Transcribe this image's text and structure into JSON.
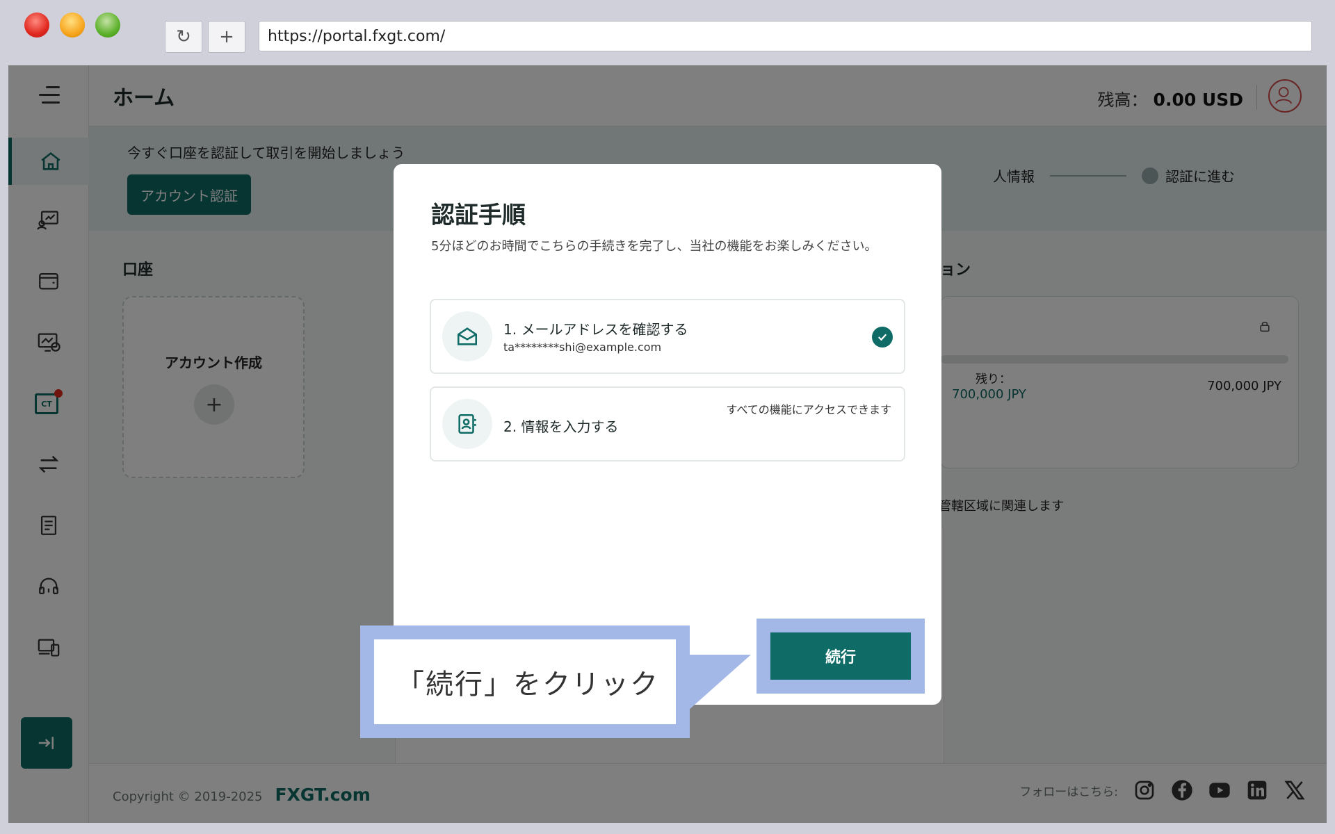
{
  "browser": {
    "url": "https://portal.fxgt.com/",
    "reload_icon": "↻",
    "new_tab_icon": "+"
  },
  "header": {
    "title": "ホーム",
    "balance_label": "残高：",
    "balance_value": "0.00 USD"
  },
  "banner": {
    "text": "今すぐ口座を認証して取引を開始しましょう",
    "verify_button": "アカウント認証",
    "step_partial": "人情報",
    "step_next": "認証に進む"
  },
  "accounts": {
    "title": "口座",
    "create_label": "アカウント作成",
    "create_icon": "+"
  },
  "promo": {
    "title_partial": "ョン",
    "remaining_label": "残り：",
    "remaining_value": "700,000 JPY",
    "total_value": "700,000 JPY",
    "region_note": "管轄区域に関連します"
  },
  "modal": {
    "title": "認証手順",
    "subtitle": "5分ほどのお時間でこちらの手続きを完了し、当社の機能をお楽しみください。",
    "steps": [
      {
        "title": "1. メールアドレスを確認する",
        "email": "ta********shi@example.com",
        "status": "completed"
      },
      {
        "title": "2. 情報を入力する",
        "note": "すべての機能にアクセスできます"
      }
    ],
    "continue_button": "続行"
  },
  "callout": {
    "text": "「続行」をクリック"
  },
  "footer": {
    "copyright": "Copyright © 2019-2025",
    "brand": "FXGT.com",
    "follow_label": "フォローはこちら:",
    "social": [
      "instagram-icon",
      "facebook-icon",
      "youtube-icon",
      "linkedin-icon",
      "x-icon"
    ]
  },
  "colors": {
    "primary": "#0e6b65",
    "callout": "#a3b8e6",
    "alert": "#e0281e"
  }
}
